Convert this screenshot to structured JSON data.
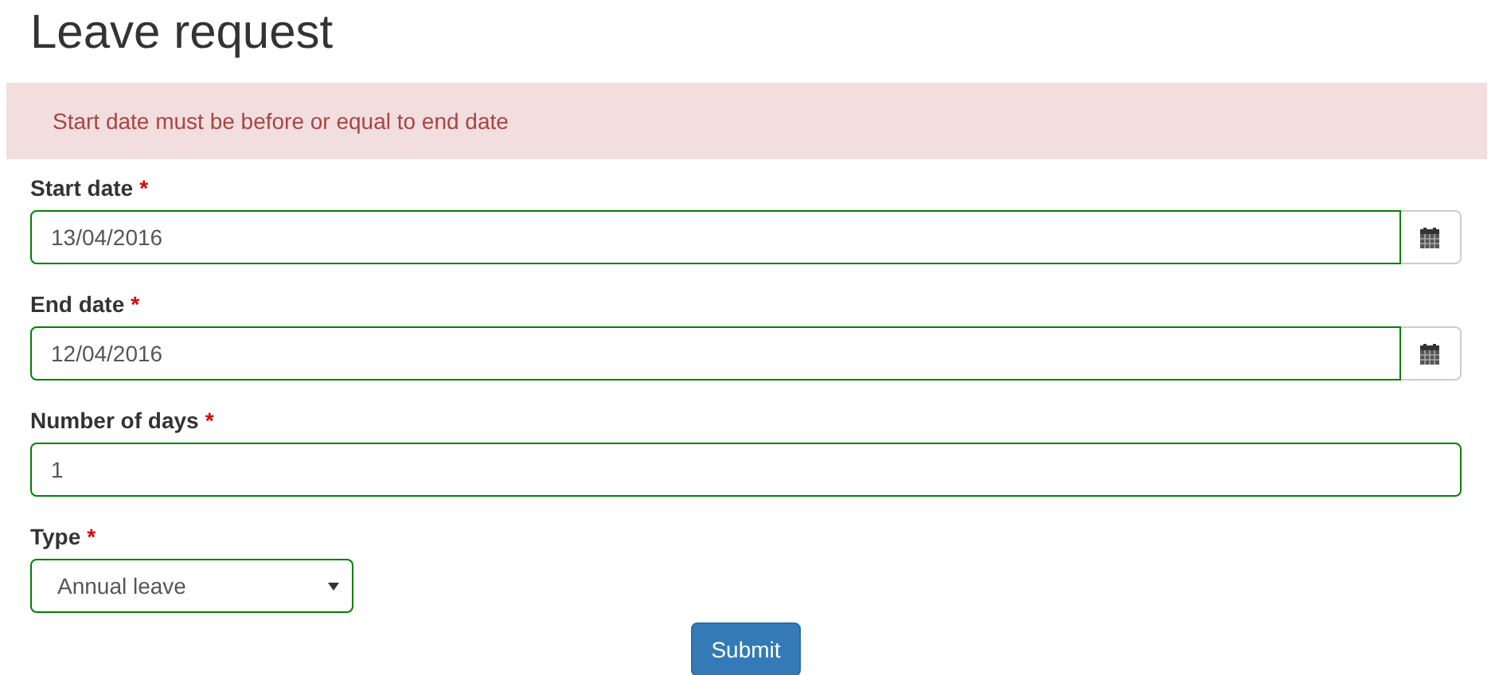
{
  "title": "Leave request",
  "alert": {
    "text": "Start date must be before or equal to end date"
  },
  "fields": [
    {
      "kind": "date",
      "label": "Start date",
      "required_mark": "*",
      "value": "13/04/2016",
      "valid": true
    },
    {
      "kind": "date",
      "label": "End date",
      "required_mark": "*",
      "value": "12/04/2016",
      "valid": true
    },
    {
      "kind": "number",
      "label": "Number of days",
      "required_mark": "*",
      "value": "1",
      "valid": true
    },
    {
      "kind": "select",
      "label": "Type",
      "required_mark": "*",
      "value": "Annual leave",
      "valid": true
    }
  ],
  "submit": {
    "label": "Submit"
  }
}
